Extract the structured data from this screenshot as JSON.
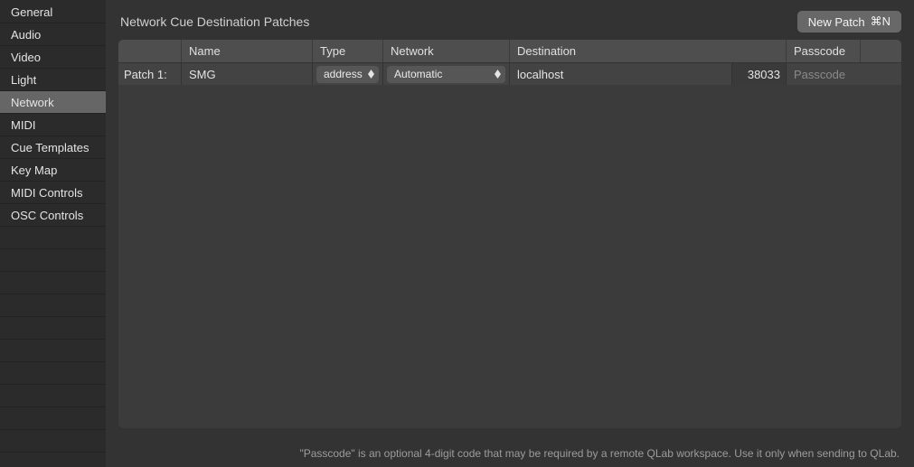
{
  "sidebar": {
    "items": [
      {
        "label": "General"
      },
      {
        "label": "Audio"
      },
      {
        "label": "Video"
      },
      {
        "label": "Light"
      },
      {
        "label": "Network",
        "selected": true
      },
      {
        "label": "MIDI"
      },
      {
        "label": "Cue Templates"
      },
      {
        "label": "Key Map"
      },
      {
        "label": "MIDI Controls"
      },
      {
        "label": "OSC Controls"
      }
    ]
  },
  "header": {
    "title": "Network Cue Destination Patches",
    "new_patch_label": "New Patch",
    "new_patch_shortcut": "⌘N"
  },
  "table": {
    "columns": {
      "name": "Name",
      "type": "Type",
      "network": "Network",
      "destination": "Destination",
      "passcode": "Passcode"
    },
    "rows": [
      {
        "index_label": "Patch 1:",
        "name": "SMG",
        "type": "address",
        "network": "Automatic",
        "destination": "localhost",
        "port": "38033",
        "passcode": "",
        "passcode_placeholder": "Passcode"
      }
    ]
  },
  "footer": {
    "hint": "\"Passcode\" is an optional 4-digit code that may be required by a remote QLab workspace. Use it only when sending to QLab."
  }
}
